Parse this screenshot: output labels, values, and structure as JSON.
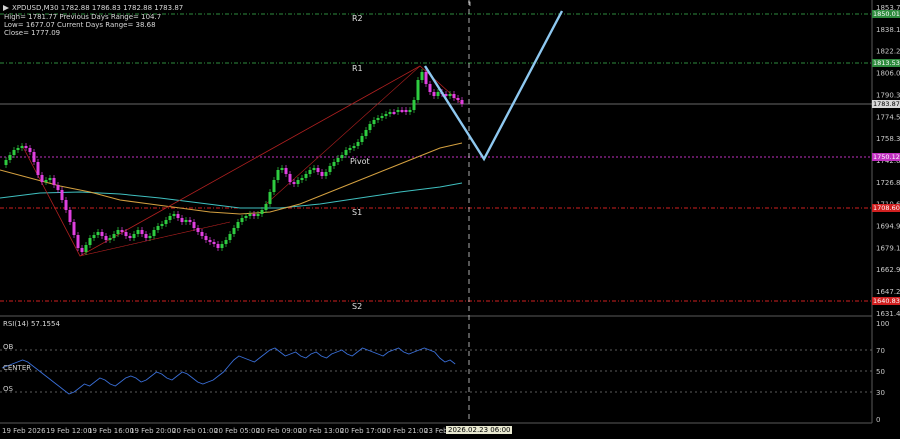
{
  "symbol_line": "XPDUSD,M30  1782.88 1786.83 1782.88 1783.87",
  "info_lines": [
    "High= 1781.77    Previous Days Range= 104.7",
    "Low= 1677.07    Current Days Range= 38.68",
    "Close= 1777.09"
  ],
  "levels": {
    "r2": "R2",
    "r1": "R1",
    "pivot": "Pivot",
    "s1": "S1",
    "s2": "S2"
  },
  "price_axis": [
    "1853.70",
    "1838.10",
    "1822.25",
    "1806.05",
    "1790.30",
    "1774.55",
    "1758.35",
    "1742.60",
    "1726.85",
    "1710.65",
    "1694.90",
    "1679.15",
    "1662.95",
    "1647.20",
    "1631.45"
  ],
  "price_tags": {
    "r2": "1850.01",
    "r1": "1813.53",
    "current": "1783.87",
    "pivot": "1750.12",
    "s1": "1708.60",
    "s2": "1640.83"
  },
  "rsi": {
    "title": "RSI(14) 57.1554",
    "ob": "OB",
    "center": "CENTER",
    "os": "OS",
    "axis": [
      "100",
      "70",
      "50",
      "30",
      "0"
    ]
  },
  "time_axis": [
    "19 Feb 2026",
    "19 Feb 12:00",
    "19 Feb 16:00",
    "19 Feb 20:00",
    "20 Feb 01:00",
    "20 Feb 05:00",
    "20 Feb 09:00",
    "20 Feb 13:00",
    "20 Feb 17:00",
    "20 Feb 21:00",
    "23 Feb"
  ],
  "cursor_time": "2026.02.23 06:00",
  "colors": {
    "bull": "#2ecc40",
    "bear": "#e040e0",
    "r_line": "#2e8b3e",
    "s_line": "#d02020",
    "pivot_line": "#c030c0",
    "ma_slow": "#40c0c0",
    "ma_fast": "#d4a040",
    "rsi_line": "#3a6fd8",
    "projection": "#8ec8f0"
  }
}
